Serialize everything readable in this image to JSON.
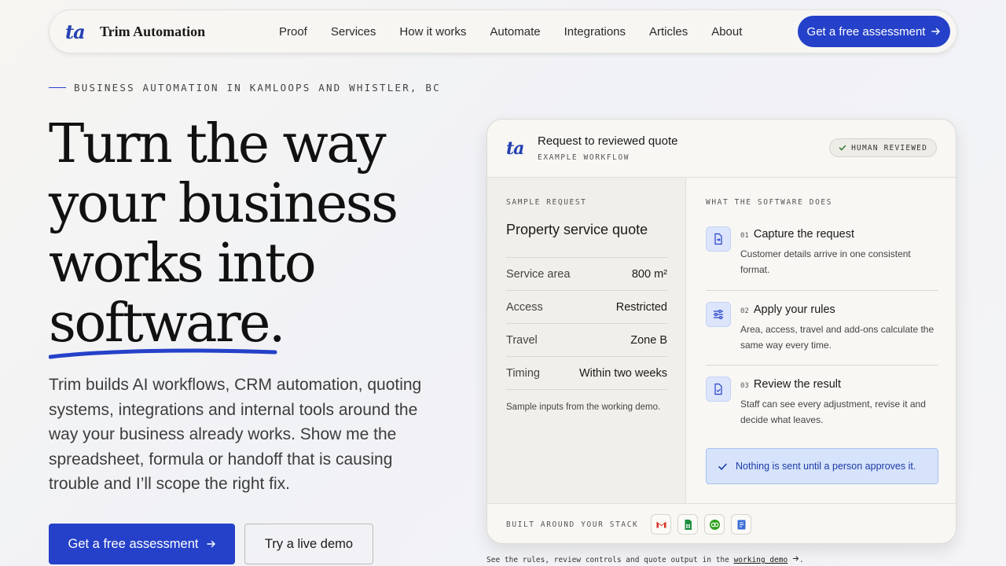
{
  "nav": {
    "brand_mark": "ta",
    "brand_name": "Trim Automation",
    "links": [
      "Proof",
      "Services",
      "How it works",
      "Automate",
      "Integrations",
      "Articles",
      "About"
    ],
    "cta_label": "Get a free assessment"
  },
  "hero": {
    "eyebrow": "BUSINESS AUTOMATION IN KAMLOOPS AND WHISTLER, BC",
    "title_lines": [
      "Turn the way",
      "your business",
      "works into",
      "software."
    ],
    "body": "Trim builds AI workflows, CRM automation, quoting systems, integrations and internal tools around the way your business already works. Show me the spreadsheet, formula or handoff that is causing trouble and I’ll scope the right fix.",
    "primary_label": "Get a free assessment",
    "secondary_label": "Try a live demo"
  },
  "card": {
    "logo": "ta",
    "title": "Request to reviewed quote",
    "subtitle": "EXAMPLE WORKFLOW",
    "badge": "HUMAN REVIEWED",
    "left": {
      "label": "SAMPLE REQUEST",
      "title": "Property service quote",
      "rows": [
        {
          "key": "Service area",
          "value": "800 m²"
        },
        {
          "key": "Access",
          "value": "Restricted"
        },
        {
          "key": "Travel",
          "value": "Zone B"
        },
        {
          "key": "Timing",
          "value": "Within two weeks"
        }
      ],
      "note": "Sample inputs from the working demo."
    },
    "right": {
      "label": "WHAT THE SOFTWARE DOES",
      "steps": [
        {
          "num": "01",
          "title": "Capture the request",
          "desc": "Customer details arrive in one consistent format.",
          "icon": "file-import-icon"
        },
        {
          "num": "02",
          "title": "Apply your rules",
          "desc": "Area, access, travel and add-ons calculate the same way every time.",
          "icon": "sliders-icon"
        },
        {
          "num": "03",
          "title": "Review the result",
          "desc": "Staff can see every adjustment, revise it and decide what leaves.",
          "icon": "document-check-icon"
        }
      ],
      "approve": "Nothing is sent until a person approves it."
    },
    "footer_label": "BUILT AROUND YOUR STACK",
    "stack_icons": [
      "gmail-icon",
      "google-sheets-icon",
      "quickbooks-icon",
      "google-forms-icon"
    ]
  },
  "below_card": {
    "before": "See the rules, review controls and quote output in the ",
    "link": "working demo",
    "after": "."
  },
  "colors": {
    "accent": "#2541c9",
    "approve_bg": "#d6e3fb"
  }
}
